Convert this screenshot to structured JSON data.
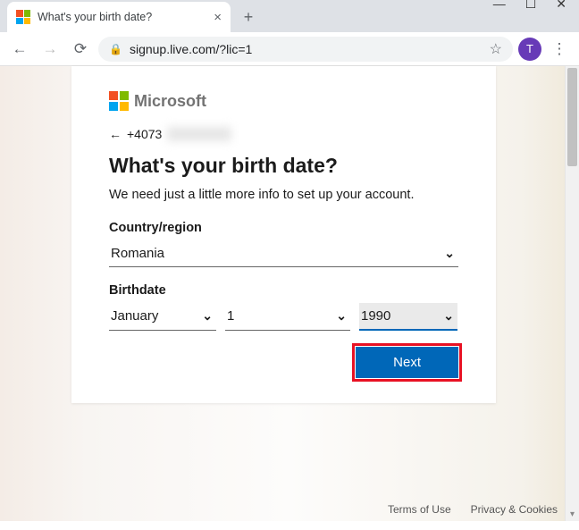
{
  "browser": {
    "tab_title": "What's your birth date?",
    "url": "signup.live.com/?lic=1",
    "avatar_initial": "T"
  },
  "page": {
    "brand": "Microsoft",
    "identity_prefix": "+4073",
    "headline": "What's your birth date?",
    "subtext": "We need just a little more info to set up your account.",
    "country_label": "Country/region",
    "country_value": "Romania",
    "birthdate_label": "Birthdate",
    "month_value": "January",
    "day_value": "1",
    "year_value": "1990",
    "next_label": "Next"
  },
  "footer": {
    "terms": "Terms of Use",
    "privacy": "Privacy & Cookies"
  }
}
